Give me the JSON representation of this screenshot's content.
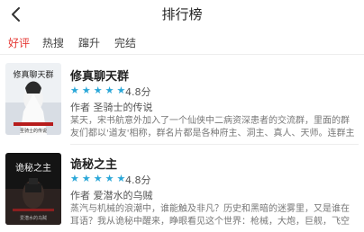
{
  "header": {
    "title": "排行榜"
  },
  "tabs": [
    {
      "label": "好评",
      "active": true
    },
    {
      "label": "热搜",
      "active": false
    },
    {
      "label": "蹿升",
      "active": false
    },
    {
      "label": "完结",
      "active": false
    }
  ],
  "books": [
    {
      "name": "修真聊天群",
      "stars": "★★★★★",
      "score": "4.8分",
      "author": "作者 圣骑士的传说",
      "desc": "某天，宋书航意外加入了一个仙侠中二病资深患者的交流群，里面的群友们都以'道友'相称，群名片都是各种府主、洞主、真人、天师。连群主",
      "cover_title": "修真聊天群",
      "cover_author": "圣骑士的传说"
    },
    {
      "name": "诡秘之主",
      "stars": "★★★★★",
      "score": "4.8分",
      "author": "作者 爱潜水的乌贼",
      "desc": "蒸汽与机械的浪潮中，谁能触及非凡？历史和黑暗的迷雾里，又是谁在耳语？我从诡秘中醒来，睁眼看见这个世界：枪械，大炮，巨舰，飞空",
      "cover_title": "诡秘之主",
      "cover_author": "爱潜水的乌贼"
    }
  ],
  "colors": {
    "accent": "#e53935",
    "star": "#2aa7d8"
  },
  "icons": {
    "back": "chevron-left-icon"
  }
}
